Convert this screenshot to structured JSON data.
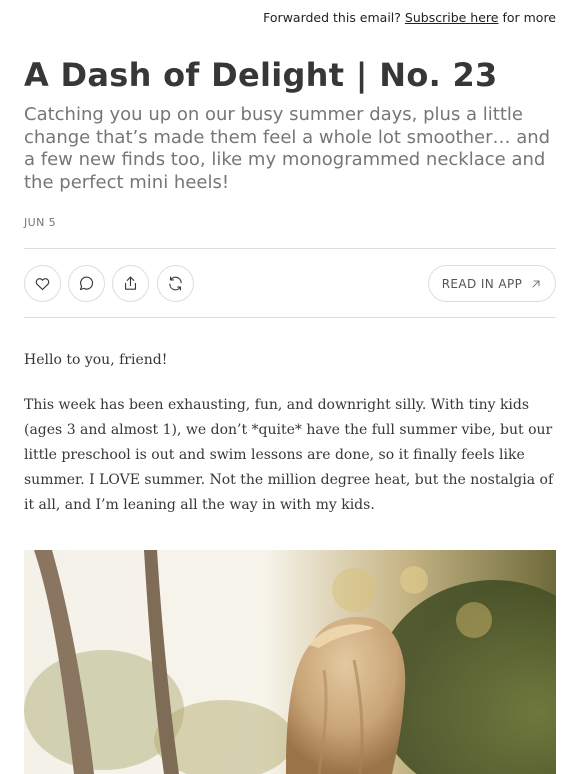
{
  "topbar": {
    "prefix": "Forwarded this email?",
    "link": "Subscribe here",
    "suffix": "for more"
  },
  "post": {
    "title": "A Dash of Delight | No. 23",
    "subtitle": "Catching you up on our busy summer days, plus a little change that’s made them feel a whole lot smoother… and a few new finds too, like my monogrammed necklace and the perfect mini heels!",
    "date": "JUN 5"
  },
  "actions": {
    "icons": [
      "heart-icon",
      "comment-icon",
      "share-icon",
      "restack-icon"
    ],
    "read_in_app": "READ IN APP"
  },
  "content": {
    "greeting": "Hello to you, friend!",
    "paragraph": "This week has been exhausting, fun, and downright silly. With tiny kids (ages 3 and almost 1), we don’t *quite* have the full summer vibe, but our little preschool is out and swim lessons are done, so it finally feels like summer. I LOVE summer. Not the million degree heat, but the nostalgia of it all, and I’m leaning all the way in with my kids."
  }
}
